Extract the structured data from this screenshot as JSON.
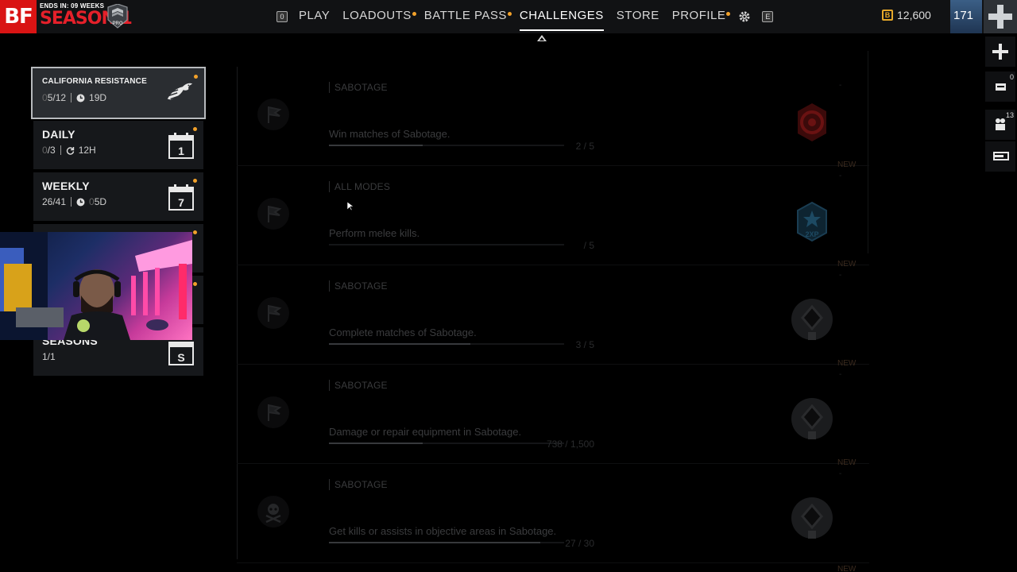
{
  "topbar": {
    "logo_text": "BF",
    "season_ends": "ENDS IN: 09 WEEKS",
    "season_title": "SEASON 1",
    "rank_label": "PRO",
    "nav_left_key": "0",
    "nav_right_key": "E",
    "nav_items": [
      {
        "label": "PLAY",
        "dot": false,
        "active": false
      },
      {
        "label": "LOADOUTS",
        "dot": true,
        "active": false
      },
      {
        "label": "BATTLE PASS",
        "dot": true,
        "active": false
      },
      {
        "label": "CHALLENGES",
        "dot": false,
        "active": true
      },
      {
        "label": "STORE",
        "dot": false,
        "active": false
      },
      {
        "label": "PROFILE",
        "dot": true,
        "active": false
      }
    ],
    "currency_icon": "B",
    "currency_value": "12,600",
    "level": "171"
  },
  "rail": {
    "inbox_count": "0",
    "squad_count": "13"
  },
  "menu": [
    {
      "title": "CALIFORNIA RESISTANCE",
      "progress": "5/12",
      "progress_dim": "0",
      "time": "19D",
      "time_icon": "clock-icon",
      "icon": "eagle-icon",
      "selected": true,
      "dot": true
    },
    {
      "title": "DAILY",
      "progress": "/3",
      "progress_dim": "0",
      "time": "12H",
      "time_icon": "refresh-icon",
      "icon": "calendar-icon",
      "icon_label": "1",
      "selected": false,
      "dot": true
    },
    {
      "title": "WEEKLY",
      "progress": "26/41",
      "progress_dim": "",
      "time": "5D",
      "time_dim": "0",
      "time_icon": "clock-icon",
      "icon": "calendar-icon",
      "icon_label": "7",
      "selected": false,
      "dot": true
    },
    {
      "title": "SEASONS",
      "progress": "1/1",
      "progress_dim": "",
      "time": "",
      "time_icon": "",
      "icon": "season-icon",
      "icon_label": "S",
      "selected": false,
      "dot": false
    }
  ],
  "challenges": [
    {
      "mode": "SABOTAGE",
      "description": "Win matches of Sabotage.",
      "progress": "2 / 5",
      "fraction": 0.4,
      "new": false,
      "dash": "-",
      "icon": "flag-icon",
      "reward": "red-badge-icon"
    },
    {
      "mode": "ALL MODES",
      "description": "Perform melee kills.",
      "progress": "/ 5",
      "fraction": 0.0,
      "new": true,
      "dash": "-",
      "icon": "flag-icon",
      "reward": "2xp-token-icon",
      "reward_label": "2XP"
    },
    {
      "mode": "SABOTAGE",
      "description": "Complete matches of Sabotage.",
      "progress": "3 / 5",
      "fraction": 0.6,
      "new": true,
      "dash": "-",
      "icon": "flag-icon",
      "reward": "diamond-badge-icon"
    },
    {
      "mode": "SABOTAGE",
      "description": "Damage or repair equipment in Sabotage.",
      "progress": "738 / 1,500",
      "fraction": 0.4,
      "new": true,
      "dash": "-",
      "icon": "flag-icon",
      "reward": "diamond-badge-icon"
    },
    {
      "mode": "SABOTAGE",
      "description": "Get kills or assists in objective areas in Sabotage.",
      "progress": "27 / 30",
      "fraction": 0.9,
      "new": true,
      "dash": "-",
      "icon": "skull-icon",
      "reward": "diamond-badge-icon"
    }
  ],
  "trailing_new": "NEW",
  "colors": {
    "accent_orange": "#f2a12a",
    "logo_red": "#d91414",
    "season_red": "#e5202a",
    "coin_gold": "#e6a82a"
  }
}
